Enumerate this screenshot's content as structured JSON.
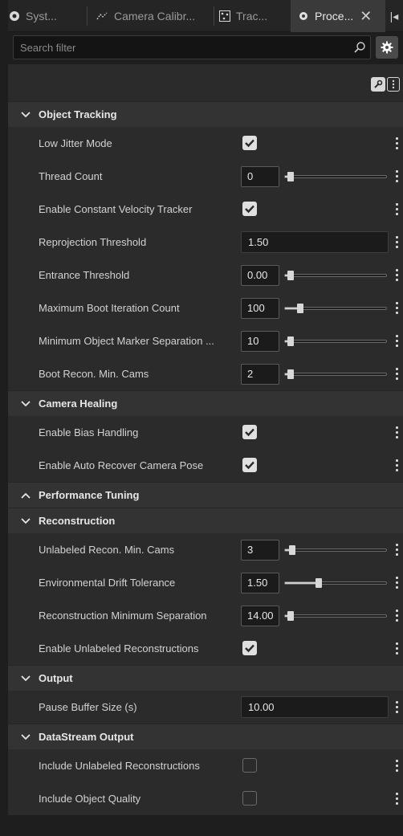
{
  "tabs": [
    {
      "label": "Syst...",
      "icon": "system-gear-icon"
    },
    {
      "label": "Camera Calibr...",
      "icon": "camera-calibration-icon"
    },
    {
      "label": "Trac...",
      "icon": "tracking-dots-icon"
    },
    {
      "label": "Proce...",
      "icon": "processing-icon",
      "active": true
    }
  ],
  "search": {
    "placeholder": "Search filter",
    "value": ""
  },
  "sections": [
    {
      "title": "Object Tracking",
      "expanded": true,
      "rows": [
        {
          "label": "Low Jitter Mode",
          "type": "checkbox",
          "checked": true
        },
        {
          "label": "Thread Count",
          "type": "slider",
          "value": "0",
          "fraction": 0.0
        },
        {
          "label": "Enable Constant Velocity Tracker",
          "type": "checkbox",
          "checked": true
        },
        {
          "label": "Reprojection Threshold",
          "type": "text",
          "value": "1.50"
        },
        {
          "label": "Entrance Threshold",
          "type": "slider",
          "value": "0.00",
          "fraction": 0.0
        },
        {
          "label": "Maximum Boot Iteration Count",
          "type": "slider",
          "value": "100",
          "fraction": 0.1
        },
        {
          "label": "Minimum Object Marker Separation ...",
          "type": "slider",
          "value": "10",
          "fraction": 0.0
        },
        {
          "label": "Boot Recon. Min. Cams",
          "type": "slider",
          "value": "2",
          "fraction": 0.0
        }
      ]
    },
    {
      "title": "Camera Healing",
      "expanded": true,
      "rows": [
        {
          "label": "Enable Bias Handling",
          "type": "checkbox",
          "checked": true
        },
        {
          "label": "Enable Auto Recover Camera Pose",
          "type": "checkbox",
          "checked": true
        }
      ]
    },
    {
      "title": "Performance Tuning",
      "expanded": false,
      "rows": []
    },
    {
      "title": "Reconstruction",
      "expanded": true,
      "rows": [
        {
          "label": "Unlabeled Recon. Min. Cams",
          "type": "slider",
          "value": "3",
          "fraction": 0.02
        },
        {
          "label": "Environmental Drift Tolerance",
          "type": "slider",
          "value": "1.50",
          "fraction": 0.3
        },
        {
          "label": "Reconstruction Minimum Separation",
          "type": "slider",
          "value": "14.00",
          "fraction": 0.0
        },
        {
          "label": "Enable Unlabeled Reconstructions",
          "type": "checkbox",
          "checked": true
        }
      ]
    },
    {
      "title": "Output",
      "expanded": true,
      "rows": [
        {
          "label": "Pause Buffer Size (s)",
          "type": "text",
          "value": "10.00"
        }
      ]
    },
    {
      "title": "DataStream Output",
      "expanded": true,
      "rows": [
        {
          "label": "Include Unlabeled Reconstructions",
          "type": "checkbox",
          "checked": false
        },
        {
          "label": "Include Object Quality",
          "type": "checkbox",
          "checked": false
        }
      ]
    }
  ]
}
